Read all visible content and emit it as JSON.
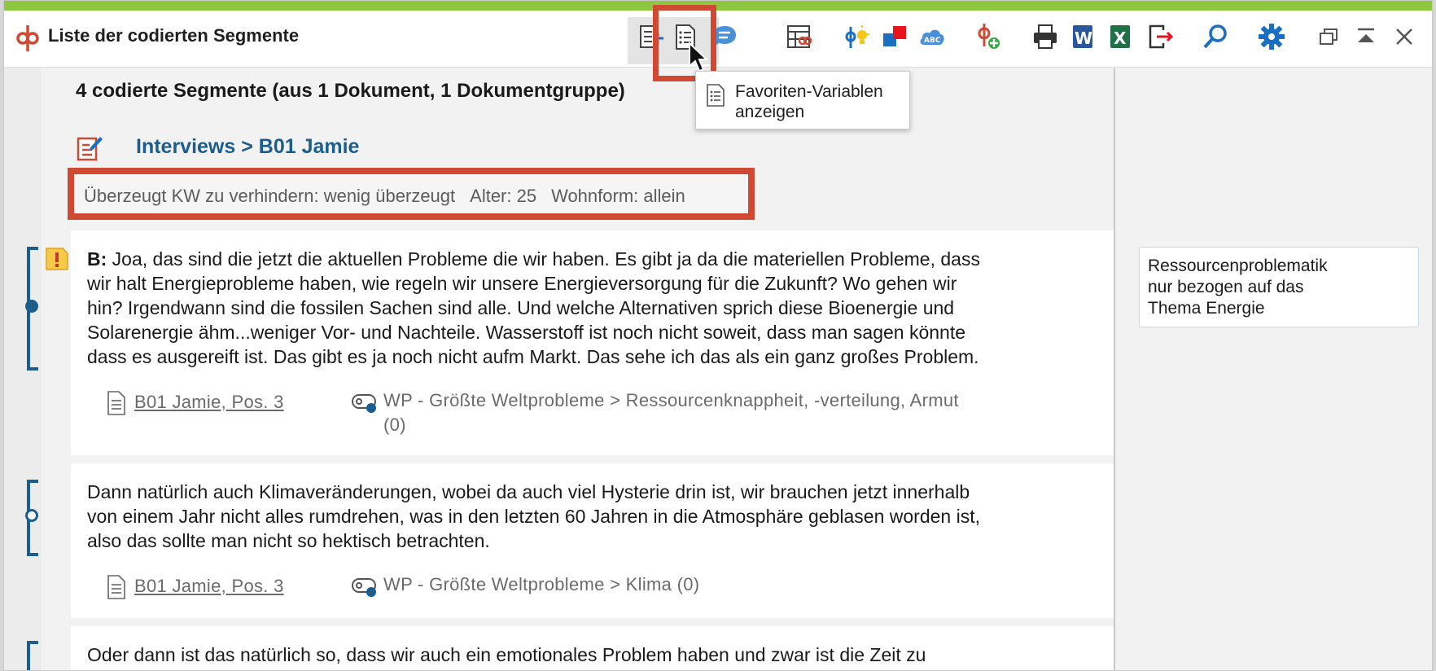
{
  "window": {
    "title": "Liste der codierten Segmente"
  },
  "toolbar": {
    "buttons": [
      {
        "name": "Dokumentvariablen",
        "icon": "document-arrow-icon"
      },
      {
        "name": "Favoriten-Variablen anzeigen",
        "icon": "variables-list-icon",
        "active": true
      },
      {
        "name": "Kommentare",
        "icon": "comment-icon"
      },
      {
        "name": "Tabelle",
        "icon": "table-codes-icon"
      },
      {
        "name": "Code-Idee",
        "icon": "code-bulb-icon"
      },
      {
        "name": "Farbe",
        "icon": "color-squares-icon"
      },
      {
        "name": "Wortwolke",
        "icon": "word-cloud-icon"
      },
      {
        "name": "Neuer Code",
        "icon": "new-code-icon"
      },
      {
        "name": "Drucken",
        "icon": "print-icon"
      },
      {
        "name": "Word",
        "icon": "word-icon"
      },
      {
        "name": "Excel",
        "icon": "excel-icon"
      },
      {
        "name": "Exportieren",
        "icon": "export-icon"
      },
      {
        "name": "Suchen",
        "icon": "search-icon"
      },
      {
        "name": "Einstellungen",
        "icon": "gear-icon"
      },
      {
        "name": "Fenster lösen",
        "icon": "restore-window-icon"
      },
      {
        "name": "Nach oben",
        "icon": "move-top-icon"
      },
      {
        "name": "Schließen",
        "icon": "close-icon"
      }
    ]
  },
  "tooltip": {
    "text": "Favoriten-Variablen\nanzeigen"
  },
  "header": {
    "segment_count": "4 codierte Segmente (aus 1 Dokument, 1 Dokumentgruppe)",
    "document_title": "Interviews > B01 Jamie"
  },
  "variables": [
    {
      "text": "Überzeugt KW zu verhindern: wenig überzeugt"
    },
    {
      "text": "Alter: 25"
    },
    {
      "text": "Wohnform: allein"
    }
  ],
  "segments": [
    {
      "speaker": "B:",
      "lines": [
        "Joa, das sind die jetzt die aktuellen Probleme die wir haben. Es gibt ja da die materiellen Probleme, dass",
        "wir halt Energieprobleme haben, wie regeln wir unsere Energieversorgung für die Zukunft? Wo gehen wir",
        "hin? Irgendwann sind die fossilen Sachen sind alle. Und welche Alternativen sprich diese Bioenergie und",
        "Solarenergie ähm...weniger Vor- und Nachteile. Wasserstoff ist noch nicht soweit, dass man sagen könnte",
        "dass es ausgereift ist. Das gibt es ja noch nicht aufm Markt. Das sehe ich das als ein ganz großes Problem."
      ],
      "source": "B01 Jamie, Pos. 3",
      "code_line1": "WP - Größte Weltprobleme > Ressourcenknappheit, -verteilung, Armut",
      "code_line2": "(0)"
    },
    {
      "speaker": "",
      "lines": [
        "Dann natürlich auch Klimaveränderungen, wobei da auch viel Hysterie drin ist, wir brauchen jetzt innerhalb",
        "von einem Jahr nicht alles rumdrehen, was in den letzten 60 Jahren in die Atmosphäre geblasen worden ist,",
        "also das sollte man nicht so hektisch betrachten."
      ],
      "source": "B01 Jamie, Pos. 3",
      "code_line1": "WP - Größte Weltprobleme > Klima (0)",
      "code_line2": ""
    },
    {
      "speaker": "",
      "lines": [
        "Oder dann ist das natürlich so, dass wir auch ein emotionales Problem haben und zwar ist die Zeit zu"
      ]
    }
  ],
  "memo": {
    "text": "Ressourcenproblematik\nnur bezogen auf das\nThema Energie"
  },
  "colors": {
    "accent_green": "#8dc63f",
    "highlight_red": "#d04a33",
    "link_blue": "#1b5e8e"
  }
}
